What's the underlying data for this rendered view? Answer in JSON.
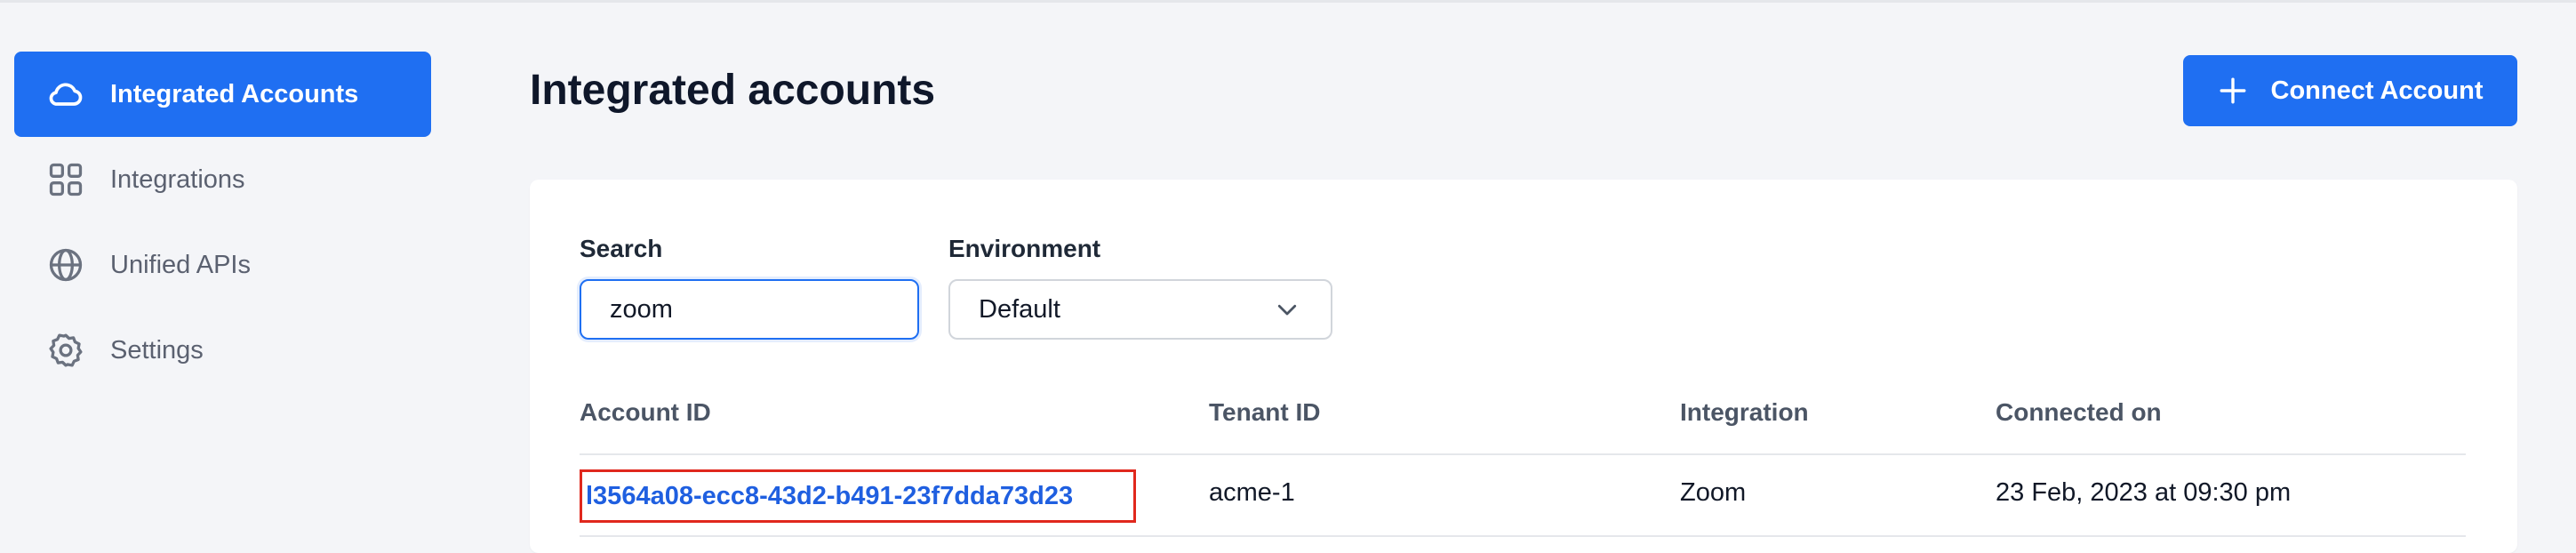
{
  "sidebar": {
    "items": [
      {
        "label": "Integrated Accounts",
        "icon": "cloud-icon",
        "active": true
      },
      {
        "label": "Integrations",
        "icon": "grid-icon",
        "active": false
      },
      {
        "label": "Unified APIs",
        "icon": "globe-icon",
        "active": false
      },
      {
        "label": "Settings",
        "icon": "gear-icon",
        "active": false
      }
    ]
  },
  "header": {
    "title": "Integrated accounts",
    "connect_label": "Connect Account"
  },
  "filters": {
    "search_label": "Search",
    "search_value": "zoom",
    "environment_label": "Environment",
    "environment_value": "Default"
  },
  "table": {
    "columns": [
      "Account ID",
      "Tenant ID",
      "Integration",
      "Connected on"
    ],
    "rows": [
      {
        "account_id": "l3564a08-ecc8-43d2-b491-23f7dda73d23",
        "tenant_id": "acme-1",
        "integration": "Zoom",
        "connected_on": "23 Feb, 2023 at 09:30 pm"
      }
    ]
  },
  "colors": {
    "accent": "#1f6ff2",
    "highlight_border": "#e0281d",
    "background": "#f4f5f8"
  }
}
